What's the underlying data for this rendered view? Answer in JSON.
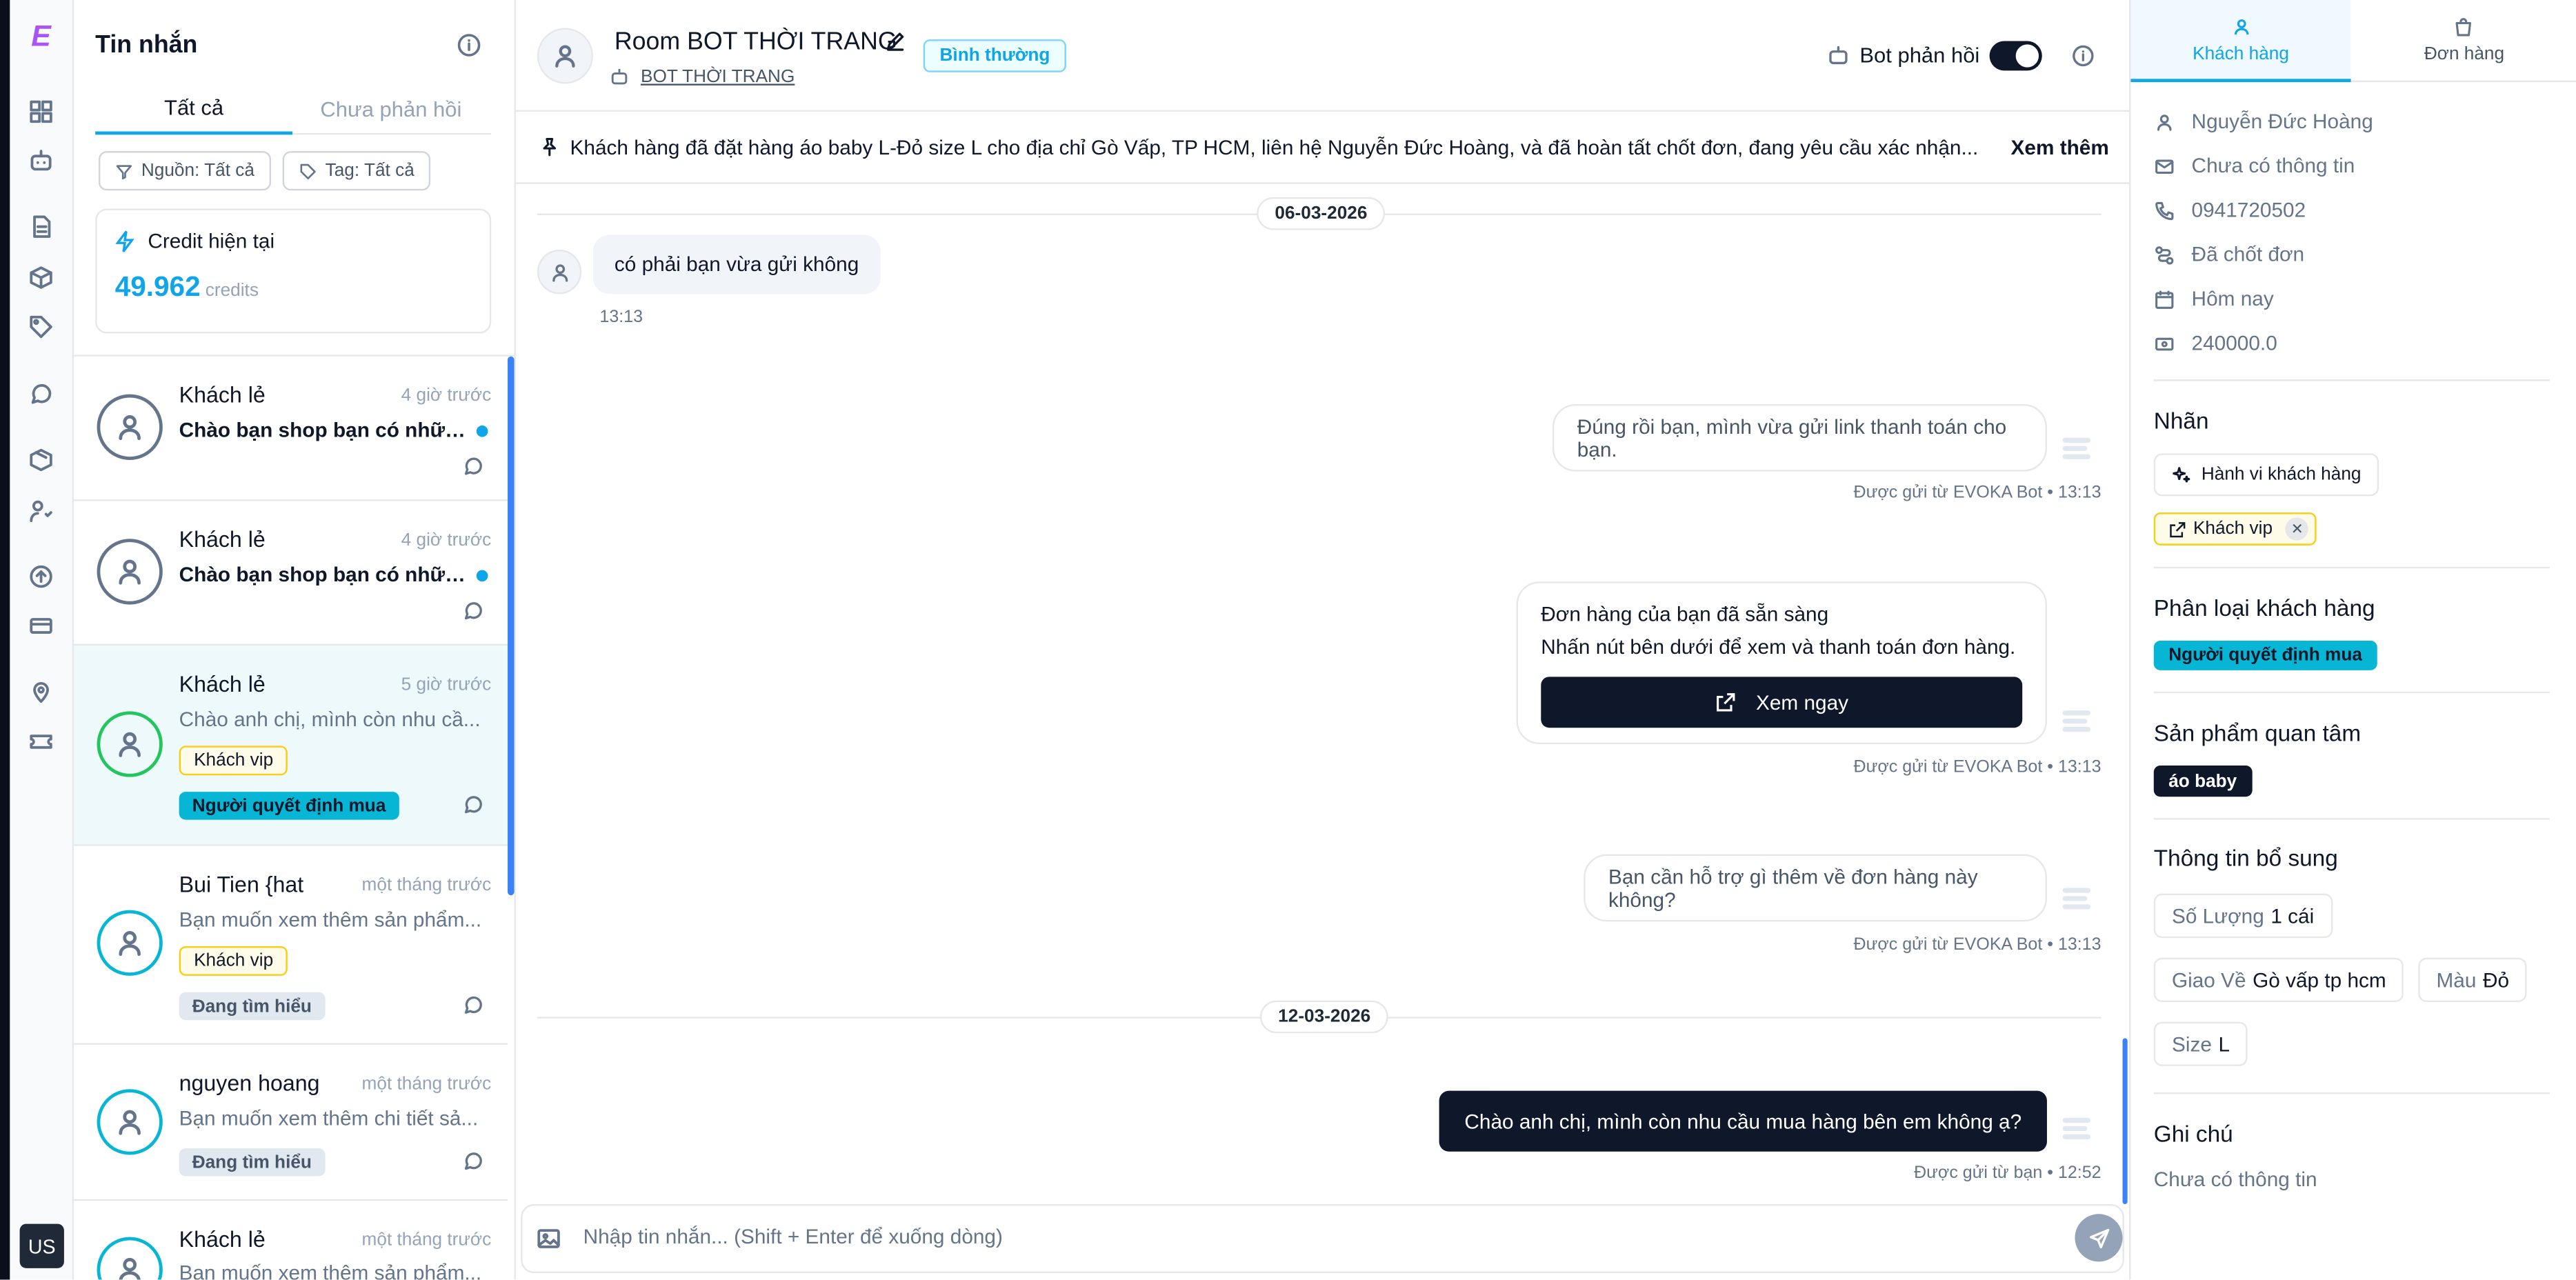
{
  "rail": {
    "logo": "E",
    "icons": [
      "dashboard-icon",
      "bot-icon",
      "document-icon",
      "box-icon",
      "tag-icon",
      "chat-icon",
      "package-icon",
      "users-icon",
      "upload-icon",
      "card-icon",
      "location-icon",
      "ticket-icon"
    ],
    "user_badge": "US"
  },
  "inbox": {
    "title": "Tin nhắn",
    "tabs": [
      "Tất cả",
      "Chưa phản hồi"
    ],
    "filter_source": "Nguồn: Tất cả",
    "filter_tag": "Tag: Tất cả",
    "credit_label": "Credit hiện tại",
    "credit_value": "49.962",
    "credit_unit": "credits",
    "conversations": [
      {
        "name": "Khách lẻ",
        "time": "4 giờ trước",
        "message": "Chào bạn shop bạn có những...",
        "unread": true
      },
      {
        "name": "Khách lẻ",
        "time": "4 giờ trước",
        "message": "Chào bạn shop bạn có những...",
        "unread": true
      },
      {
        "name": "Khách lẻ",
        "time": "5 giờ trước",
        "message": "Chào anh chị, mình còn nhu cầ...",
        "tag": "Khách vip",
        "badge": "Người quyết định mua"
      },
      {
        "name": "Bui Tien {hat",
        "time": "một tháng trước",
        "message": "Bạn muốn xem thêm sản phẩm...",
        "tag": "Khách vip",
        "badge": "Đang tìm hiểu"
      },
      {
        "name": "nguyen hoang",
        "time": "một tháng trước",
        "message": "Bạn muốn xem thêm chi tiết sả...",
        "badge": "Đang tìm hiểu"
      },
      {
        "name": "Khách lẻ",
        "time": "một tháng trước",
        "message": "Bạn muốn xem thêm sản phẩm..."
      }
    ]
  },
  "chat": {
    "room_title": "Room BOT THỜI TRANG",
    "status_badge": "Bình thường",
    "bot_name": "BOT THỜI TRANG",
    "bot_reply_label": "Bot phản hồi",
    "bot_reply_on": true,
    "pinned_summary": "Khách hàng đã đặt hàng áo baby L-Đỏ size L cho địa chỉ Gò Vấp, TP HCM, liên hệ Nguyễn Đức Hoàng, và đã hoàn tất chốt đơn, đang yêu cầu xác nhận...",
    "see_more": "Xem thêm",
    "date1": "06-03-2026",
    "date2": "12-03-2026",
    "messages": [
      {
        "side": "left",
        "text": "có phải bạn vừa gửi không",
        "time": "13:13"
      },
      {
        "side": "right",
        "text": "Đúng rồi bạn, mình vừa gửi link thanh toán cho bạn.",
        "meta": "Được gửi từ EVOKA Bot • 13:13"
      },
      {
        "side": "right",
        "line1": "Đơn hàng của bạn đã sẵn sàng",
        "line2": "Nhấn nút bên dưới để xem và thanh toán đơn hàng.",
        "button": "Xem ngay",
        "meta": "Được gửi từ EVOKA Bot • 13:13"
      },
      {
        "side": "right",
        "text": "Bạn cần hỗ trợ gì thêm về đơn hàng này không?",
        "meta": "Được gửi từ EVOKA Bot • 13:13"
      },
      {
        "side": "right",
        "text": "Chào anh chị, mình còn nhu cầu mua hàng bên em không ạ?",
        "meta": "Được gửi từ bạn • 12:52"
      }
    ],
    "input_placeholder": "Nhập tin nhắn... (Shift + Enter để xuống dòng)"
  },
  "customer": {
    "tabs": [
      "Khách hàng",
      "Đơn hàng"
    ],
    "name": "Nguyễn Đức Hoàng",
    "email": "Chưa có thông tin",
    "phone": "0941720502",
    "status": "Đã chốt đơn",
    "date": "Hôm nay",
    "amount": "240000.0",
    "labels_title": "Nhãn",
    "behavior_button": "Hành vi khách hàng",
    "label_tag": "Khách vip",
    "classification_title": "Phân loại khách hàng",
    "classification_value": "Người quyết định mua",
    "products_title": "Sản phẩm quan tâm",
    "product": "áo baby",
    "extra_title": "Thông tin bổ sung",
    "extra": [
      {
        "key": "Số Lượng",
        "value": "1 cái"
      },
      {
        "key": "Giao Về",
        "value": "Gò vấp tp hcm"
      },
      {
        "key": "Màu",
        "value": "Đỏ"
      },
      {
        "key": "Size",
        "value": "L"
      }
    ],
    "notes_title": "Ghi chú",
    "notes_value": "Chưa có thông tin"
  },
  "colors": {
    "accent": "#0ea5e9",
    "cyan_badge": "#06b6d4",
    "dark": "#0f172a",
    "status_green": "#22c55e"
  }
}
